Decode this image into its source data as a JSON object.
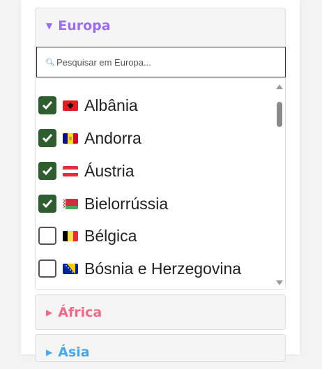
{
  "sections": [
    {
      "title": "Europa",
      "expanded": true,
      "color": "#9a6cf0",
      "search": {
        "placeholder": "Pesquisar em Europa...",
        "icon": "magnifier-icon"
      },
      "items": [
        {
          "label": "Albânia",
          "checked": true,
          "flag": "albania-flag-icon"
        },
        {
          "label": "Andorra",
          "checked": true,
          "flag": "andorra-flag-icon"
        },
        {
          "label": "Áustria",
          "checked": true,
          "flag": "austria-flag-icon"
        },
        {
          "label": "Bielorrússia",
          "checked": true,
          "flag": "belarus-flag-icon"
        },
        {
          "label": "Bélgica",
          "checked": false,
          "flag": "belgium-flag-icon"
        },
        {
          "label": "Bósnia e Herzegovina",
          "checked": false,
          "flag": "bosnia-flag-icon"
        }
      ]
    },
    {
      "title": "África",
      "expanded": false,
      "color": "#ee6a87"
    },
    {
      "title": "Ásia",
      "expanded": false,
      "color": "#4aa8e6"
    }
  ],
  "colors": {
    "checkbox_checked": "#2e5e2f"
  }
}
